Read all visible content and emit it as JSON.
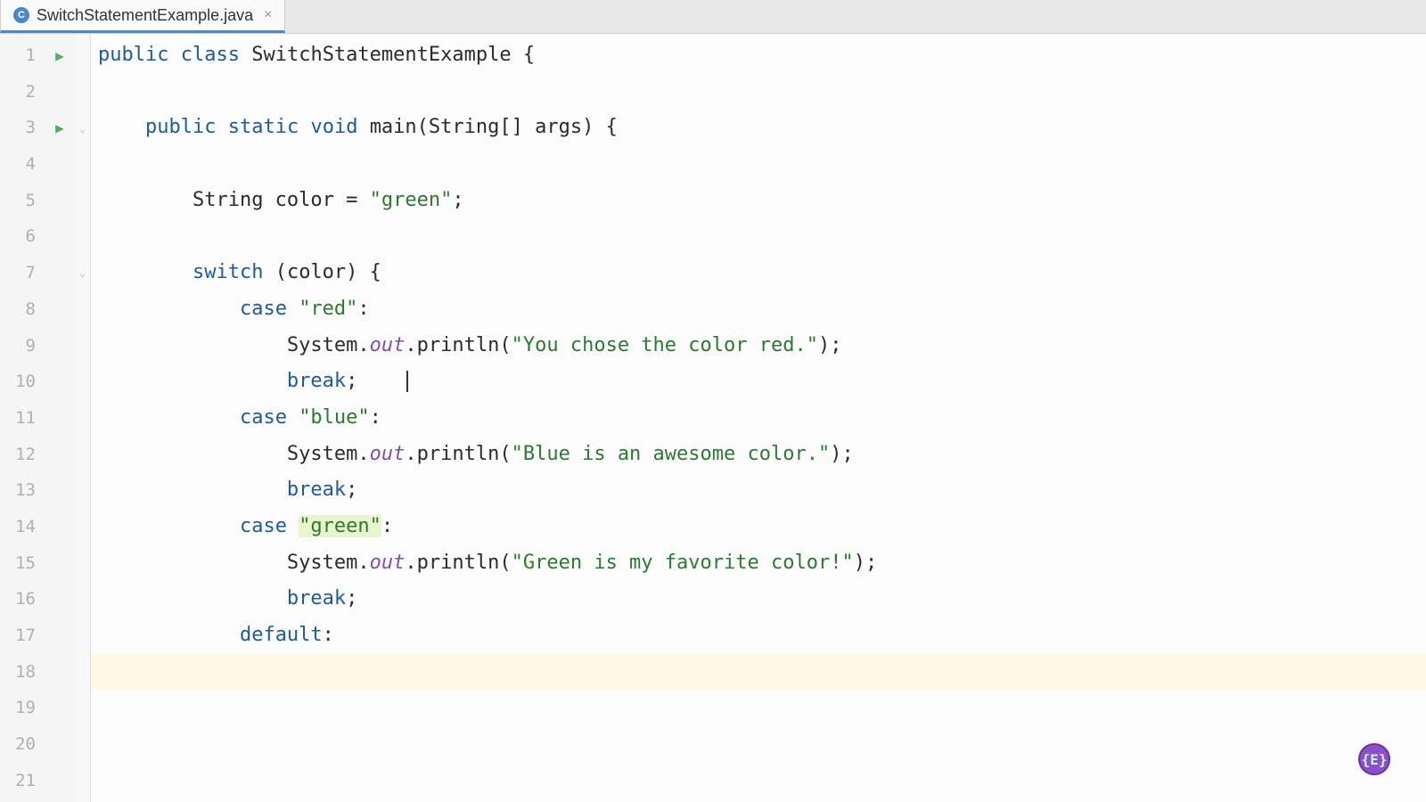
{
  "tab": {
    "filename": "SwitchStatementExample.java",
    "icon_letter": "C"
  },
  "gutter": {
    "lines": [
      "1",
      "2",
      "3",
      "4",
      "5",
      "6",
      "7",
      "8",
      "9",
      "10",
      "11",
      "12",
      "13",
      "14",
      "15",
      "16",
      "17",
      "18",
      "19",
      "20",
      "21"
    ]
  },
  "run_markers": {
    "line1": "▶",
    "line3": "▶"
  },
  "code": {
    "l1": {
      "public": "public",
      "class": "class",
      "name": "SwitchStatementExample",
      "brace": " {"
    },
    "l3": {
      "public": "public",
      "static": "static",
      "void": "void",
      "main": "main",
      "params": "(String[] args) {"
    },
    "l5": {
      "type": "String color = ",
      "val": "\"green\"",
      "semi": ";"
    },
    "l7": {
      "switch": "switch",
      "cond": " (color) {"
    },
    "l8": {
      "case": "case",
      "val": "\"red\"",
      "colon": ":"
    },
    "l9": {
      "sys": "System.",
      "out": "out",
      "print": ".println(",
      "str": "\"You chose the color red.\"",
      "end": ");"
    },
    "l10": {
      "break": "break",
      "semi": ";"
    },
    "l11": {
      "case": "case",
      "val": "\"blue\"",
      "colon": ":"
    },
    "l12": {
      "sys": "System.",
      "out": "out",
      "print": ".println(",
      "str": "\"Blue is an awesome color.\"",
      "end": ");"
    },
    "l13": {
      "break": "break",
      "semi": ";"
    },
    "l14": {
      "case": "case",
      "val": "\"green\"",
      "colon": ":"
    },
    "l15": {
      "sys": "System.",
      "out": "out",
      "print": ".println(",
      "str": "\"Green is my favorite color!\"",
      "end": ");"
    },
    "l16": {
      "break": "break",
      "semi": ";"
    },
    "l17": {
      "default": "default",
      "colon": ":"
    }
  },
  "watermark": "{E}"
}
